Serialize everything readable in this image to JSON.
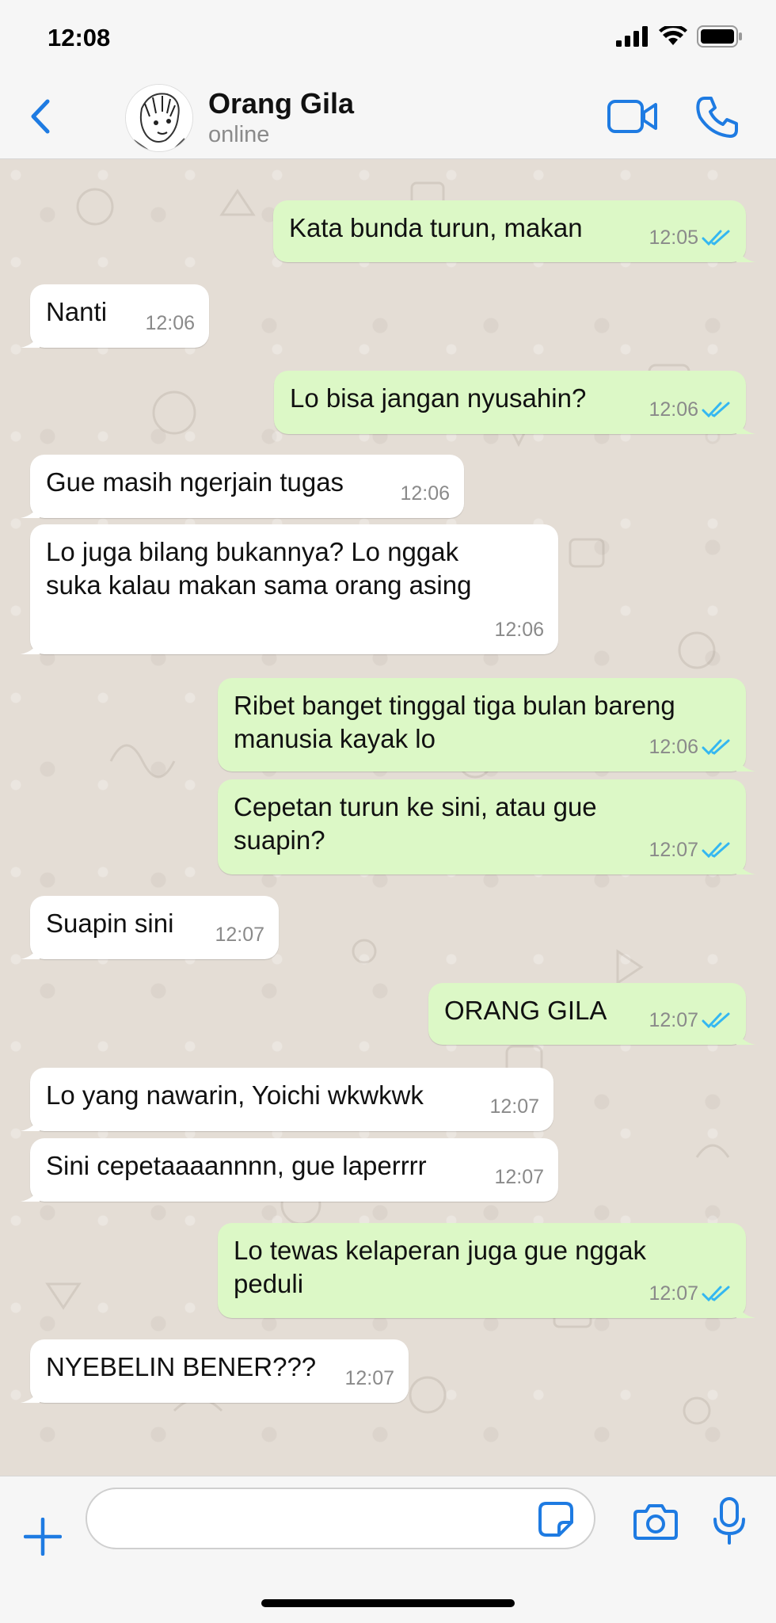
{
  "status_bar": {
    "time": "12:08"
  },
  "header": {
    "contact_name": "Orang Gila",
    "contact_status": "online"
  },
  "colors": {
    "accent": "#1e7be2",
    "bubble_out": "#dcf8c6",
    "bubble_in": "#ffffff",
    "read_tick": "#34b7f1",
    "chat_bg": "#e4ddd5"
  },
  "messages": [
    {
      "dir": "out",
      "text": "Kata bunda turun, makan",
      "time": "12:05"
    },
    {
      "dir": "in",
      "text": "Nanti",
      "time": "12:06"
    },
    {
      "dir": "out",
      "text": "Lo bisa jangan nyusahin?",
      "time": "12:06"
    },
    {
      "dir": "in",
      "text": "Gue masih ngerjain tugas",
      "time": "12:06"
    },
    {
      "dir": "in",
      "text": "Lo juga bilang bukannya? Lo nggak\nsuka kalau makan sama orang asing",
      "time": "12:06"
    },
    {
      "dir": "out",
      "text": "Ribet banget tinggal tiga bulan bareng\nmanusia kayak lo",
      "time": "12:06"
    },
    {
      "dir": "out",
      "text": "Cepetan turun ke sini, atau gue\nsuapin?",
      "time": "12:07"
    },
    {
      "dir": "in",
      "text": "Suapin sini",
      "time": "12:07"
    },
    {
      "dir": "out",
      "text": "ORANG GILA",
      "time": "12:07"
    },
    {
      "dir": "in",
      "text": "Lo yang nawarin, Yoichi wkwkwk",
      "time": "12:07"
    },
    {
      "dir": "in",
      "text": "Sini cepetaaaannnn, gue laperrrr",
      "time": "12:07"
    },
    {
      "dir": "out",
      "text": "Lo tewas kelaperan juga gue nggak\npeduli",
      "time": "12:07"
    },
    {
      "dir": "in",
      "text": "NYEBELIN BENER???",
      "time": "12:07"
    }
  ],
  "input": {
    "value": "",
    "placeholder": ""
  },
  "icons": {
    "back": "chevron-left-icon",
    "video": "video-camera-icon",
    "call": "phone-icon",
    "plus": "plus-icon",
    "sticker": "sticker-icon",
    "camera": "camera-icon",
    "mic": "microphone-icon"
  }
}
